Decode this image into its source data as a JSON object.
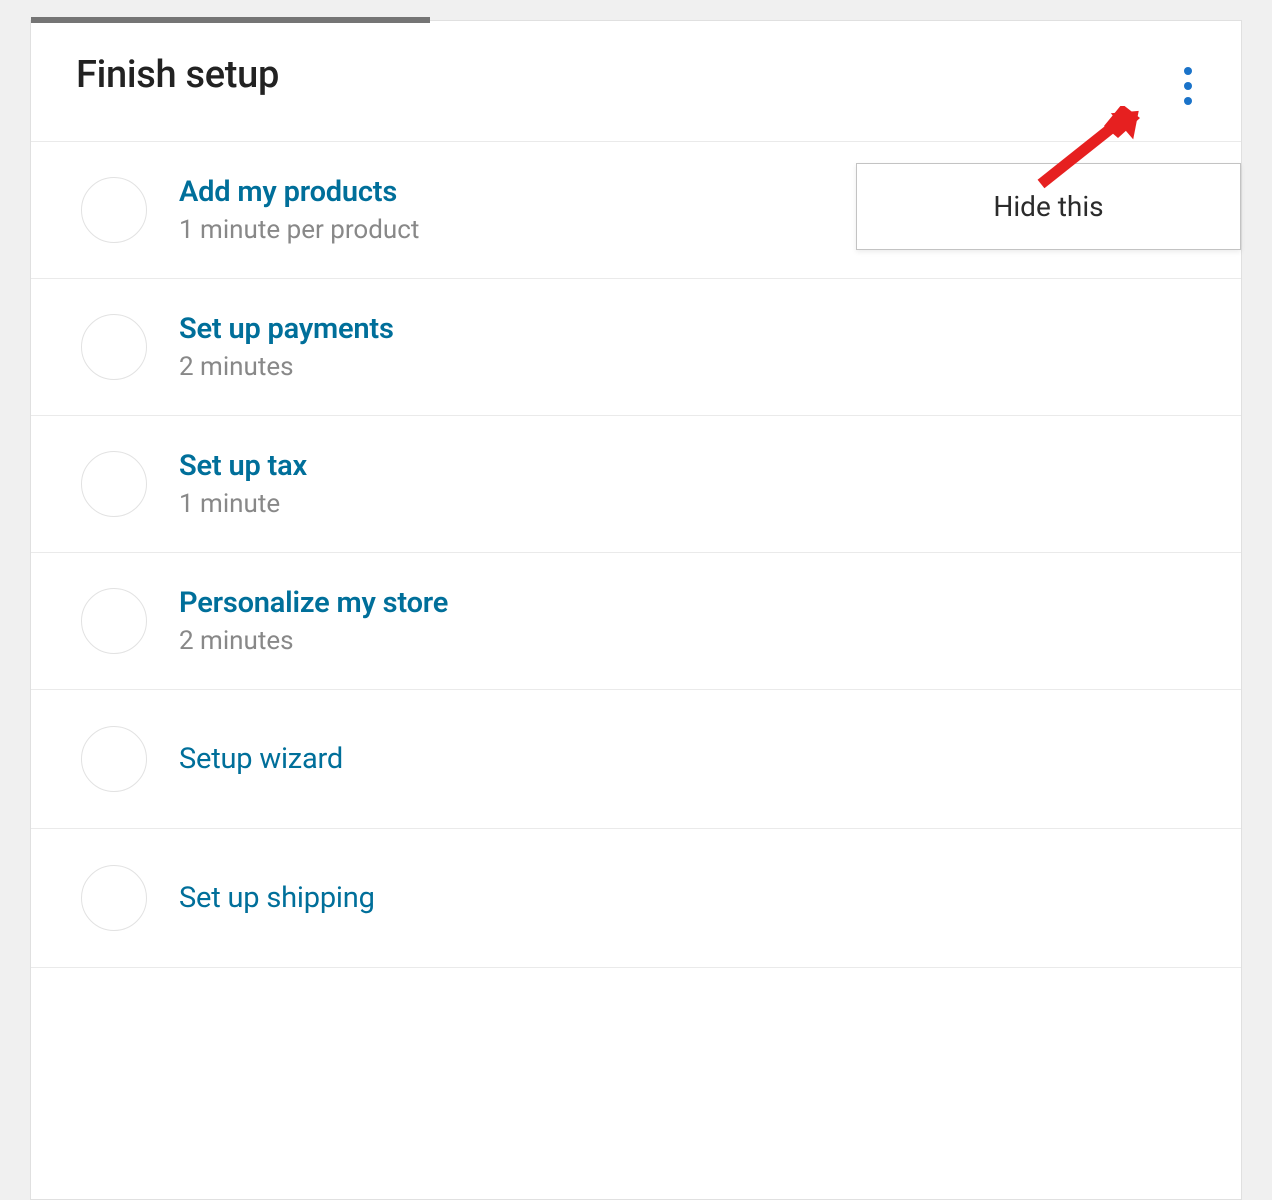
{
  "header": {
    "title": "Finish setup"
  },
  "popover": {
    "hide_label": "Hide this"
  },
  "tasks": [
    {
      "title": "Add my products",
      "subtitle": "1 minute per product"
    },
    {
      "title": "Set up payments",
      "subtitle": "2 minutes"
    },
    {
      "title": "Set up tax",
      "subtitle": "1 minute"
    },
    {
      "title": "Personalize my store",
      "subtitle": "2 minutes"
    },
    {
      "title": "Setup wizard",
      "subtitle": ""
    },
    {
      "title": "Set up shipping",
      "subtitle": ""
    }
  ],
  "colors": {
    "link": "#006f9a",
    "accent": "#1a73c9",
    "arrow": "#e62020"
  }
}
